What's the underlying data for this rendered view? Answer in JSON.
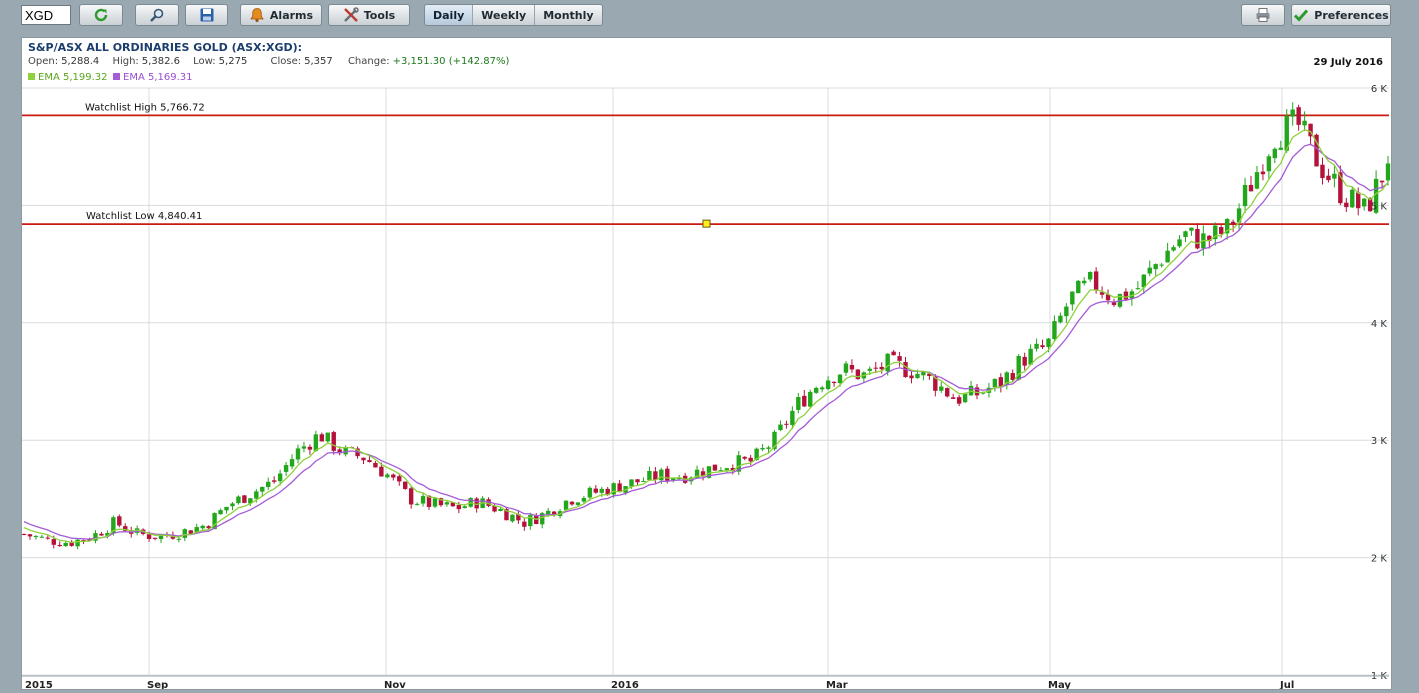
{
  "toolbar": {
    "symbol": "XGD",
    "alarms_label": "Alarms",
    "tools_label": "Tools",
    "intervals": [
      "Daily",
      "Weekly",
      "Monthly"
    ],
    "active_interval": "Daily",
    "preferences_label": "Preferences"
  },
  "header": {
    "title": "S&P/ASX ALL ORDINARIES GOLD (ASX:XGD):",
    "open_label": "Open:",
    "open": "5,288.4",
    "high_label": "High:",
    "high": "5,382.6",
    "low_label": "Low:",
    "low": "5,275",
    "close_label": "Close:",
    "close": "5,357",
    "change_label": "Change:",
    "change": "+3,151.30 (+142.87%)",
    "ema1": "EMA 5,199.32",
    "ema2": "EMA 5,169.31",
    "date": "29 July 2016"
  },
  "colors": {
    "up": "#22a61b",
    "down": "#b3123a",
    "ema_fast": "#8fd13c",
    "ema_slow": "#a45bd6",
    "watchlist_line": "#cc1a10",
    "grid": "#d8dcdf"
  },
  "chart_data": {
    "type": "candlestick",
    "x_ticks": [
      "2015",
      "Sep",
      "Nov",
      "2016",
      "Mar",
      "May",
      "Jul"
    ],
    "y_ticks": [
      "6 K",
      "5 K",
      "4 K",
      "3 K",
      "2 K",
      "1 K"
    ],
    "y_tick_values": [
      6000,
      5000,
      4000,
      3000,
      2000,
      1000
    ],
    "ylim": [
      1000,
      6000
    ],
    "annotations": [
      {
        "label": "Watchlist High 5,766.72",
        "value": 5766.72
      },
      {
        "label": "Watchlist Low 4,840.41",
        "value": 4840.41
      }
    ],
    "close_path": [
      [
        0,
        2200
      ],
      [
        2,
        2150
      ],
      [
        4,
        2130
      ],
      [
        6,
        2180
      ],
      [
        8,
        2300
      ],
      [
        10,
        2200
      ],
      [
        12,
        2180
      ],
      [
        14,
        2220
      ],
      [
        16,
        2280
      ],
      [
        18,
        2450
      ],
      [
        20,
        2550
      ],
      [
        22,
        2650
      ],
      [
        24,
        2900
      ],
      [
        26,
        3050
      ],
      [
        28,
        2900
      ],
      [
        30,
        2850
      ],
      [
        32,
        2700
      ],
      [
        34,
        2500
      ],
      [
        36,
        2450
      ],
      [
        38,
        2420
      ],
      [
        40,
        2480
      ],
      [
        42,
        2400
      ],
      [
        44,
        2300
      ],
      [
        46,
        2380
      ],
      [
        48,
        2500
      ],
      [
        50,
        2550
      ],
      [
        52,
        2600
      ],
      [
        54,
        2650
      ],
      [
        56,
        2700
      ],
      [
        58,
        2700
      ],
      [
        60,
        2750
      ],
      [
        62,
        2800
      ],
      [
        64,
        2820
      ],
      [
        66,
        3000
      ],
      [
        68,
        3300
      ],
      [
        70,
        3500
      ],
      [
        72,
        3600
      ],
      [
        74,
        3550
      ],
      [
        76,
        3650
      ],
      [
        78,
        3600
      ],
      [
        80,
        3500
      ],
      [
        82,
        3350
      ],
      [
        84,
        3400
      ],
      [
        86,
        3500
      ],
      [
        88,
        3700
      ],
      [
        90,
        3800
      ],
      [
        92,
        4200
      ],
      [
        94,
        4350
      ],
      [
        96,
        4200
      ],
      [
        98,
        4300
      ],
      [
        100,
        4550
      ],
      [
        102,
        4750
      ],
      [
        104,
        4700
      ],
      [
        106,
        4800
      ],
      [
        108,
        5200
      ],
      [
        110,
        5600
      ],
      [
        112,
        5700
      ],
      [
        114,
        5350
      ],
      [
        116,
        5100
      ],
      [
        118,
        4950
      ],
      [
        120,
        5357
      ]
    ],
    "ema_fast_last": 5199.32,
    "ema_slow_last": 5169.31
  }
}
